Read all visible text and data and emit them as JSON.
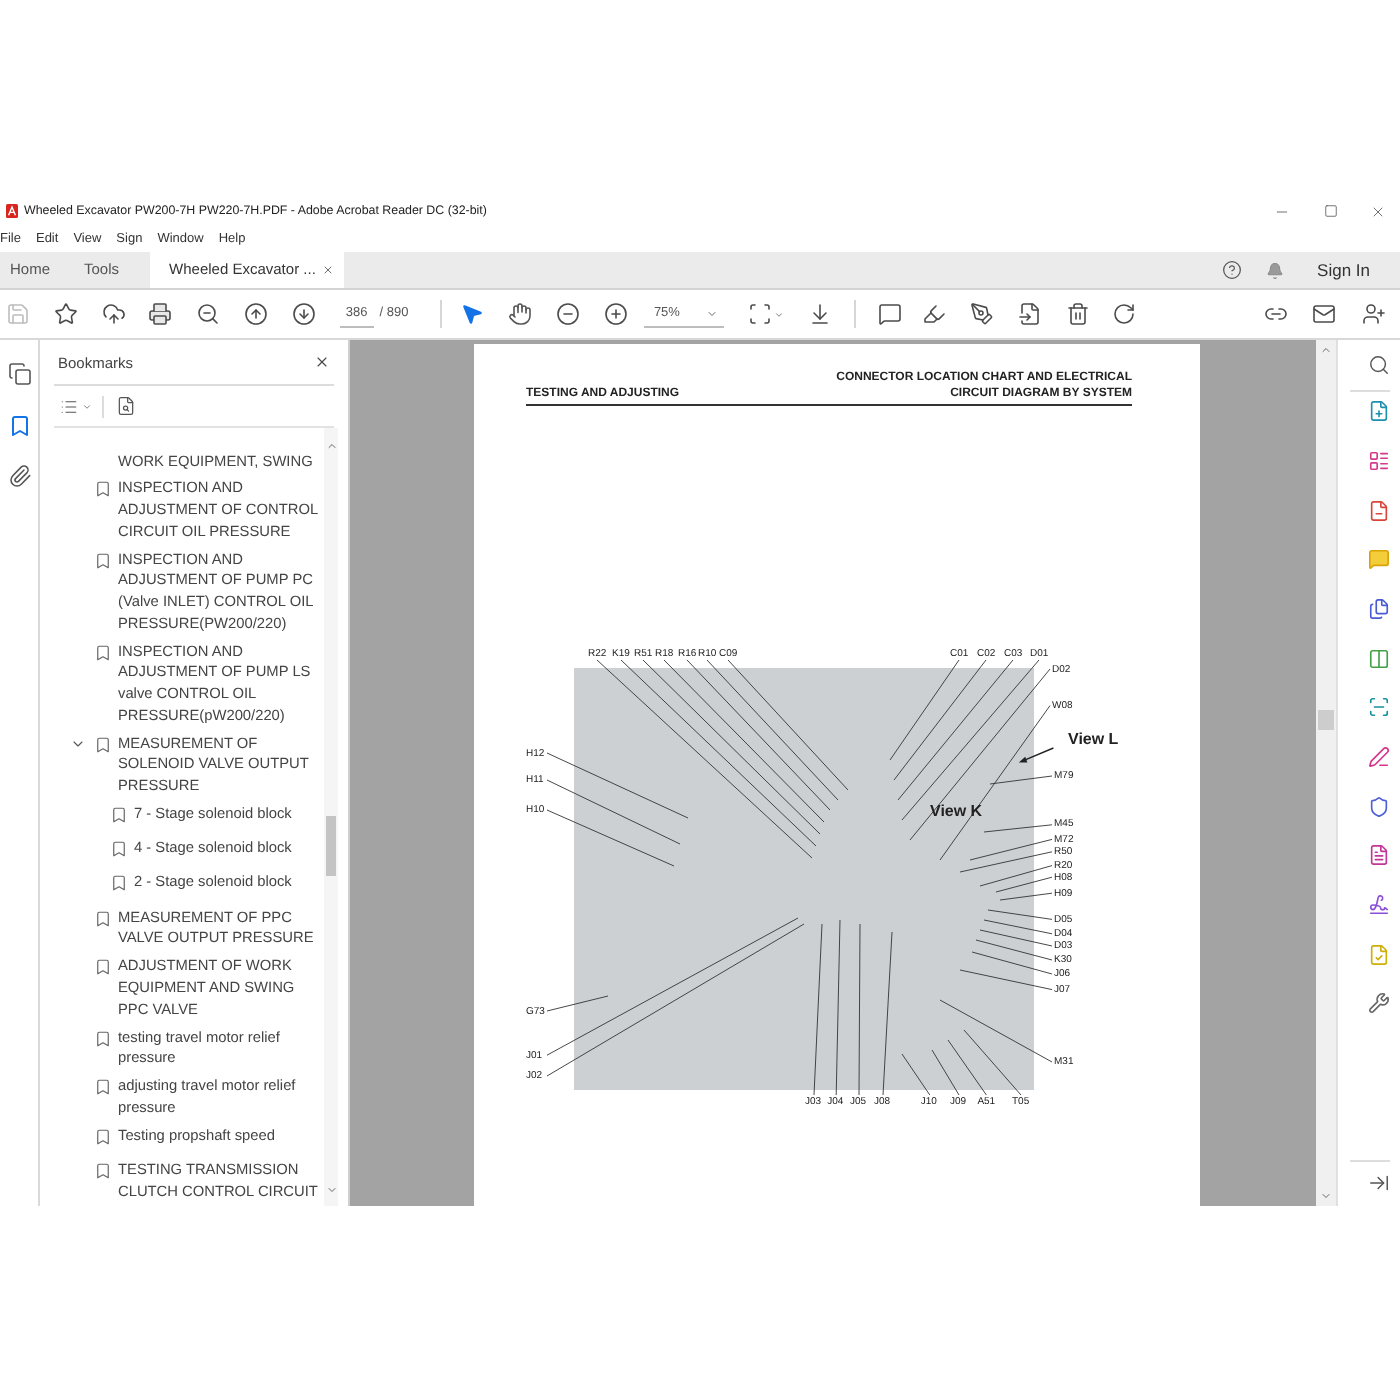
{
  "window": {
    "title": "Wheeled Excavator PW200-7H PW220-7H.PDF - Adobe Acrobat Reader DC (32-bit)"
  },
  "menu": [
    "File",
    "Edit",
    "View",
    "Sign",
    "Window",
    "Help"
  ],
  "tabs": [
    {
      "label": "Home",
      "selected": false
    },
    {
      "label": "Tools",
      "selected": false
    },
    {
      "label": "Wheeled Excavator ...",
      "selected": true,
      "closable": true
    }
  ],
  "account": {
    "sign_in": "Sign In"
  },
  "toolbar": {
    "save": {
      "disabled": true
    },
    "page": "386",
    "page_total": "/ 890",
    "zoom": "75%",
    "tools": [
      {
        "kind": "select",
        "selected": true
      },
      {
        "kind": "hand",
        "selected": false
      }
    ]
  },
  "left_rail": [
    {
      "kind": "pages",
      "selected": false
    },
    {
      "kind": "bookmarks",
      "selected": true
    },
    {
      "kind": "attachments",
      "selected": false
    }
  ],
  "bookmarks": {
    "title": "Bookmarks",
    "items": [
      {
        "kind": "continued",
        "title": "WORK EQUIPMENT, SWING"
      },
      {
        "kind": "bookmark",
        "title": "INSPECTION AND ADJUSTMENT OF CONTROL CIRCUIT OIL PRESSURE"
      },
      {
        "kind": "bookmark",
        "title": "INSPECTION AND ADJUSTMENT OF PUMP PC (Valve INLET) CONTROL OIL PRESSURE(PW200/220)"
      },
      {
        "kind": "bookmark",
        "title": "INSPECTION AND ADJUSTMENT OF PUMP LS valve CONTROL OIL PRESSURE(pW200/220)"
      },
      {
        "kind": "bookmark",
        "title": "MEASUREMENT OF SOLENOID VALVE OUTPUT PRESSURE",
        "expanded": true,
        "children": [
          {
            "kind": "bookmark",
            "title": "7 - Stage solenoid block"
          },
          {
            "kind": "bookmark",
            "title": "4 - Stage solenoid block"
          },
          {
            "kind": "bookmark",
            "title": "2 - Stage solenoid block"
          }
        ]
      },
      {
        "kind": "bookmark",
        "title": "MEASUREMENT OF PPC VALVE OUTPUT PRESSURE"
      },
      {
        "kind": "bookmark",
        "title": "ADJUSTMENT OF WORK EQUIPMENT AND SWING PPC VALVE"
      },
      {
        "kind": "bookmark",
        "title": "testing travel motor relief pressure"
      },
      {
        "kind": "bookmark",
        "title": "adjusting travel motor relief pressure"
      },
      {
        "kind": "bookmark",
        "title": "Testing propshaft speed"
      },
      {
        "kind": "bookmark",
        "title": "TESTING TRANSMISSION CLUTCH CONTROL CIRCUIT"
      }
    ]
  },
  "document": {
    "header_left": "TESTING AND ADJUSTING",
    "header_right": "CONNECTOR LOCATION CHART AND ELECTRICAL CIRCUIT DIAGRAM BY SYSTEM",
    "callouts": {
      "top": [
        "R22",
        "K19",
        "R51",
        "R18",
        "R16",
        "R10",
        "C09",
        "C01",
        "C02",
        "C03",
        "D01"
      ],
      "right": [
        "D02",
        "W08",
        "M79",
        "M45",
        "M72",
        "R50",
        "R20",
        "H08",
        "H09",
        "D05",
        "D04",
        "D03",
        "K30",
        "J06",
        "J07",
        "M31"
      ],
      "left": [
        "H12",
        "H11",
        "H10",
        "G73",
        "J01",
        "J02"
      ],
      "bottom": [
        "J03",
        "J04",
        "J05",
        "J08",
        "J10",
        "J09",
        "A51",
        "T05"
      ]
    },
    "views": [
      "View L",
      "View K"
    ]
  }
}
